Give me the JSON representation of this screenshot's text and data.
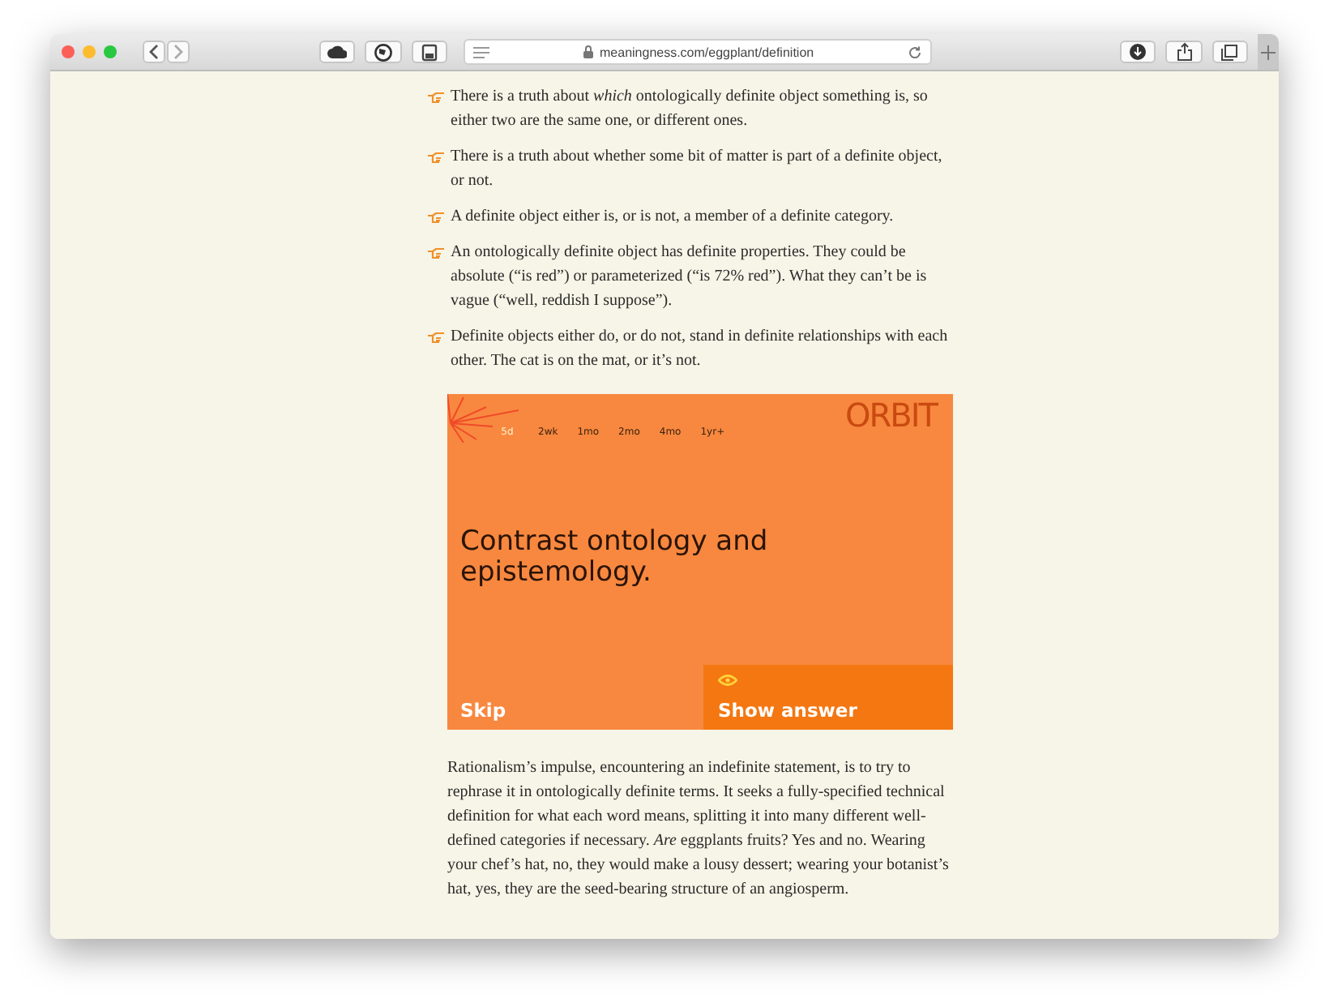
{
  "browser": {
    "url": "meaningness.com/eggplant/definition"
  },
  "bullets": [
    {
      "text": "There is a truth about *which* ontologically definite object something is, so either two are the same one, or different ones."
    },
    {
      "text": "There is a truth about whether some bit of matter is part of a definite object, or not."
    },
    {
      "text": "A definite object either is, or is not, a member of a definite category."
    },
    {
      "text": "An ontologically definite object has definite properties. They could be absolute (“is red”) or parameterized (“is 72% red”). What they can’t be is vague (“well, reddish I suppose”)."
    },
    {
      "text": "Definite objects either do, or do not, stand in definite relationships with each other. The cat is on the mat, or it’s not."
    }
  ],
  "card": {
    "logo": "ORBIT",
    "intervals": [
      {
        "label": "5d",
        "selected": true
      },
      {
        "label": "2wk",
        "selected": false
      },
      {
        "label": "1mo",
        "selected": false
      },
      {
        "label": "2mo",
        "selected": false
      },
      {
        "label": "4mo",
        "selected": false
      },
      {
        "label": "1yr+",
        "selected": false
      }
    ],
    "prompt": "Contrast ontology and epistemology.",
    "skip": "Skip",
    "show_answer": "Show answer"
  },
  "paragraph": "Rationalism’s impulse, encountering an indefinite statement, is to try to rephrase it in ontologically definite terms. It seeks a fully-specified technical definition for what each word means, splitting it into many different well-defined categories if necessary. *Are* eggplants fruits? Yes and no. Wearing your chef’s hat, no, they would make a lousy dessert; wearing your botanist’s hat, yes, they are the seed-bearing structure of an angiosperm."
}
